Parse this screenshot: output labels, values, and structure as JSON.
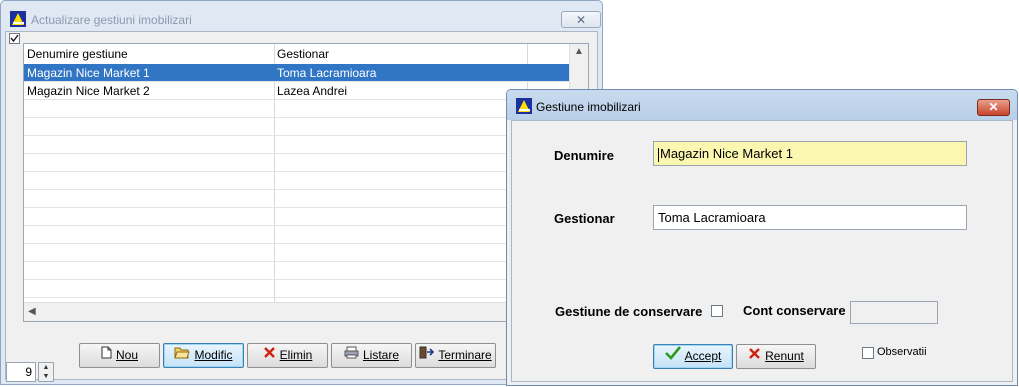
{
  "main_window": {
    "title": "Actualizare gestiuni imobilizari",
    "close_label": "✕",
    "grid": {
      "columns": [
        "Denumire gestiune",
        "Gestionar"
      ],
      "rows": [
        {
          "name": "Magazin Nice Market 1",
          "manager": "Toma Lacramioara",
          "selected": true
        },
        {
          "name": "Magazin Nice Market 2",
          "manager": "Lazea Andrei",
          "selected": false
        }
      ],
      "empty_rows": 11
    },
    "buttons": {
      "nou": "Nou",
      "modific": "Modific",
      "elimin": "Elimin",
      "listare": "Listare",
      "terminare": "Terminare"
    },
    "spinner_value": "9"
  },
  "dialog": {
    "title": "Gestiune imobilizari",
    "close_label": "✕",
    "denumire_label": "Denumire",
    "denumire_value": "Magazin Nice Market 1",
    "gestionar_label": "Gestionar",
    "gestionar_value": "Toma Lacramioara",
    "conservare_label": "Gestiune de conservare",
    "cont_label": "Cont conservare",
    "cont_value": "",
    "observatii_label": "Observatii",
    "accept_label": "Accept",
    "renunt_label": "Renunt"
  },
  "colors": {
    "selection": "#3176c5",
    "field_highlight": "#fbf7b1",
    "close_red": "#c9452a"
  }
}
